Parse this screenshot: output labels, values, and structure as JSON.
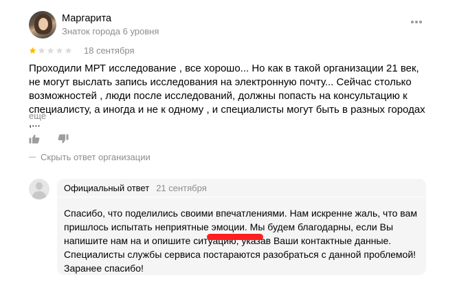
{
  "review": {
    "author_name": "Маргарита",
    "author_level": "Знаток города 6 уровня",
    "rating": 1,
    "rating_max": 5,
    "date": "18 сентября",
    "text": "Проходили МРТ исследование , все хорошо... Но как в такой организации 21 век, не могут выслать запись исследования на электронную почту... Сейчас столько возможностей , люди после исследований, должны попасть на консультацию к специалисту, а иногда и не к одному , и специалисты могут быть в разных городах ,...",
    "more_label": "ещё",
    "hide_reply_label": "Скрыть ответ организации"
  },
  "official_reply": {
    "title": "Официальный ответ",
    "date": "21 сентября",
    "text": "Спасибо, что поделились своими впечатлениями. Нам искренне жаль, что вам пришлось испытать неприятные эмоции. Мы будем благодарны, если Вы напишите нам на                  и опишите ситуацию, указав Ваши контактные данные. Специалисты службы сервиса постараются разобраться с данной проблемой! Заранее спасибо!"
  },
  "icons": {
    "more": "more-dots-icon",
    "like": "thumbs-up-icon",
    "dislike": "thumbs-down-icon",
    "star": "star-icon"
  },
  "colors": {
    "star_filled": "#ffb800",
    "star_empty": "#dcdcdc",
    "muted_text": "#8c8c8c",
    "reply_bg": "#f5f5f5",
    "redaction": "#ff1e1e"
  }
}
